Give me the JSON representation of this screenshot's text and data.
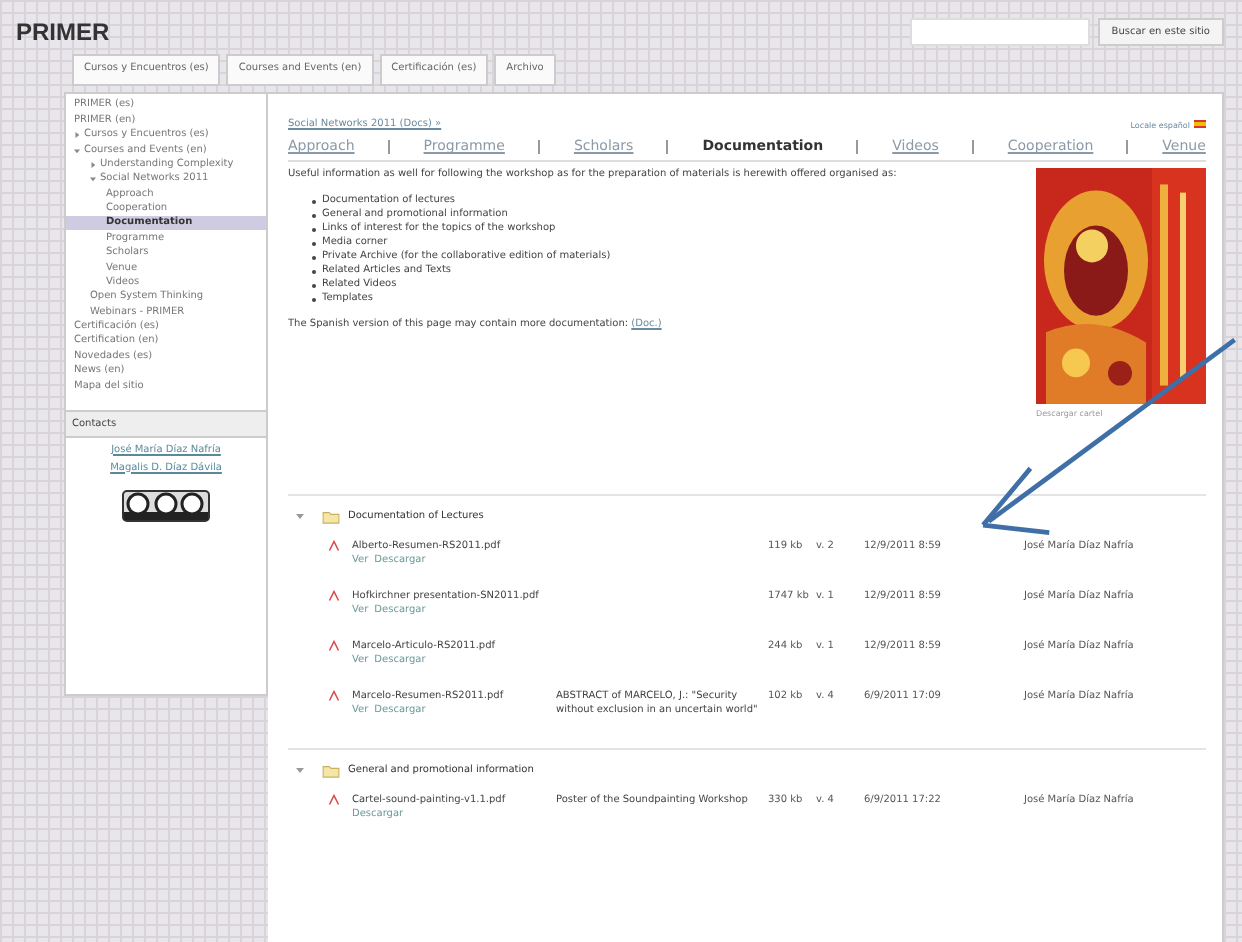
{
  "header": {
    "title": "PRIMER",
    "search": {
      "button": "Buscar en este sitio"
    }
  },
  "nav_tabs": [
    "Cursos y Encuentros (es)",
    "Courses and Events (en)",
    "Certificación (es)",
    "Archivo"
  ],
  "sidebar": {
    "items": [
      {
        "label": "PRIMER (es)",
        "selected": false
      },
      {
        "label": "PRIMER (en)",
        "selected": false
      },
      {
        "label": "Cursos y Encuentros (es)",
        "selected": false,
        "expanded": false
      },
      {
        "label": "Courses and Events (en)",
        "selected": false,
        "expanded": true,
        "children": [
          {
            "label": "Understanding Complexity",
            "selected": false,
            "expanded": false
          },
          {
            "label": "Social Networks 2011",
            "selected": false,
            "expanded": true,
            "children": [
              {
                "label": "Approach",
                "selected": false
              },
              {
                "label": "Cooperation",
                "selected": false
              },
              {
                "label": "Documentation",
                "selected": true
              },
              {
                "label": "Programme",
                "selected": false
              },
              {
                "label": "Scholars",
                "selected": false
              },
              {
                "label": "Venue",
                "selected": false
              },
              {
                "label": "Videos",
                "selected": false
              }
            ]
          },
          {
            "label": "Open System Thinking",
            "selected": false
          },
          {
            "label": "Webinars - PRIMER",
            "selected": false
          }
        ]
      },
      {
        "label": "Certificación (es)",
        "selected": false
      },
      {
        "label": "Certification (en)",
        "selected": false
      },
      {
        "label": "Novedades (es)",
        "selected": false
      },
      {
        "label": "News (en)",
        "selected": false
      },
      {
        "label": "Mapa del sitio",
        "selected": false
      }
    ],
    "contacts": {
      "title": "Contacts",
      "links": [
        "José María Díaz Nafría",
        "Magalis D. Díaz Dávila"
      ]
    }
  },
  "content": {
    "breadcrumb": "Social Networks 2011 (Docs) »",
    "locale": "Locale español",
    "tabs": [
      {
        "label": "Approach",
        "selected": false
      },
      {
        "label": "Programme",
        "selected": false
      },
      {
        "label": "Scholars",
        "selected": false
      },
      {
        "label": "Documentation",
        "selected": true
      },
      {
        "label": "Videos",
        "selected": false
      },
      {
        "label": "Cooperation",
        "selected": false
      },
      {
        "label": "Venue",
        "selected": false
      }
    ],
    "intro": "Useful information as well for following the workshop as for the preparation of materials is herewith offered organised as:",
    "bullets": [
      "Documentation of lectures",
      "General and promotional information",
      "Links of interest for the topics of the workshop",
      "Media corner",
      "Private Archive (for the collaborative edition of materials)",
      "Related Articles and Texts",
      "Related Videos",
      "Templates"
    ],
    "note": {
      "text": "The Spanish version of this page may contain more documentation:",
      "link": "(Doc.)"
    },
    "poster_caption": "Descargar cartel",
    "sections": [
      {
        "title": "Documentation of Lectures",
        "expanded": true,
        "files": [
          {
            "name": "Alberto-Resumen-RS2011.pdf",
            "actions": [
              "Ver",
              "Descargar"
            ],
            "size": "119 kb",
            "version": "v. 2",
            "date": "12/9/2011 8:59",
            "author": "José María Díaz Nafría"
          },
          {
            "name": "Hofkirchner presentation-SN2011.pdf",
            "actions": [
              "Ver",
              "Descargar"
            ],
            "size": "1747 kb",
            "version": "v. 1",
            "date": "12/9/2011 8:59",
            "author": "José María Díaz Nafría"
          },
          {
            "name": "Marcelo-Articulo-RS2011.pdf",
            "actions": [
              "Ver",
              "Descargar"
            ],
            "size": "244 kb",
            "version": "v. 1",
            "date": "12/9/2011 8:59",
            "author": "José María Díaz Nafría"
          },
          {
            "name": "Marcelo-Resumen-RS2011.pdf",
            "actions": [
              "Ver",
              "Descargar"
            ],
            "description": "ABSTRACT of MARCELO, J.: \"Security without exclusion in an uncertain world\"",
            "size": "102 kb",
            "version": "v. 4",
            "date": "6/9/2011 17:09",
            "author": "José María Díaz Nafría"
          }
        ]
      },
      {
        "title": "General and promotional information",
        "expanded": true,
        "files": [
          {
            "name": "Cartel-sound-painting-v1.1.pdf",
            "actions": [
              "Descargar"
            ],
            "description": "Poster of the Soundpainting Workshop",
            "size": "330 kb",
            "version": "v. 4",
            "date": "6/9/2011 17:22",
            "author": "José María Díaz Nafría"
          }
        ]
      }
    ]
  }
}
